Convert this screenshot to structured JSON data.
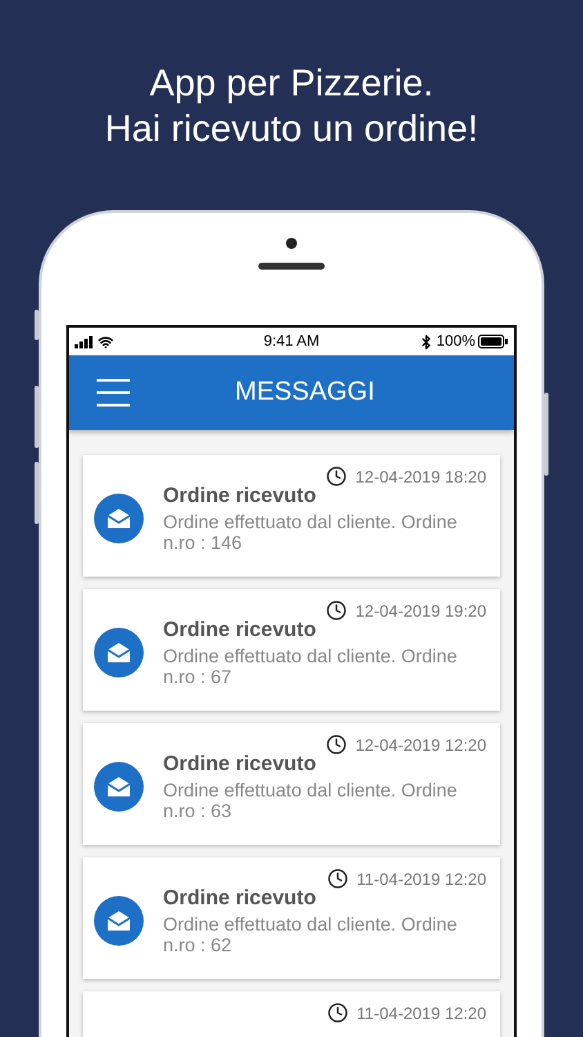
{
  "headline": [
    "App per Pizzerie.",
    "Hai ricevuto un ordine!"
  ],
  "status_bar": {
    "time": "9:41 AM",
    "battery": "100%"
  },
  "header": {
    "title": "MESSAGGI"
  },
  "messages": [
    {
      "time": "12-04-2019 18:20",
      "title": "Ordine ricevuto",
      "body": "Ordine effettuato dal cliente. Ordine n.ro :  146"
    },
    {
      "time": "12-04-2019 19:20",
      "title": "Ordine ricevuto",
      "body": "Ordine effettuato dal cliente. Ordine n.ro :  67"
    },
    {
      "time": "12-04-2019 12:20",
      "title": "Ordine ricevuto",
      "body": "Ordine effettuato dal cliente. Ordine n.ro :  63"
    },
    {
      "time": "11-04-2019 12:20",
      "title": "Ordine ricevuto",
      "body": "Ordine effettuato dal cliente. Ordine n.ro :  62"
    },
    {
      "time": "11-04-2019 12:20"
    }
  ]
}
